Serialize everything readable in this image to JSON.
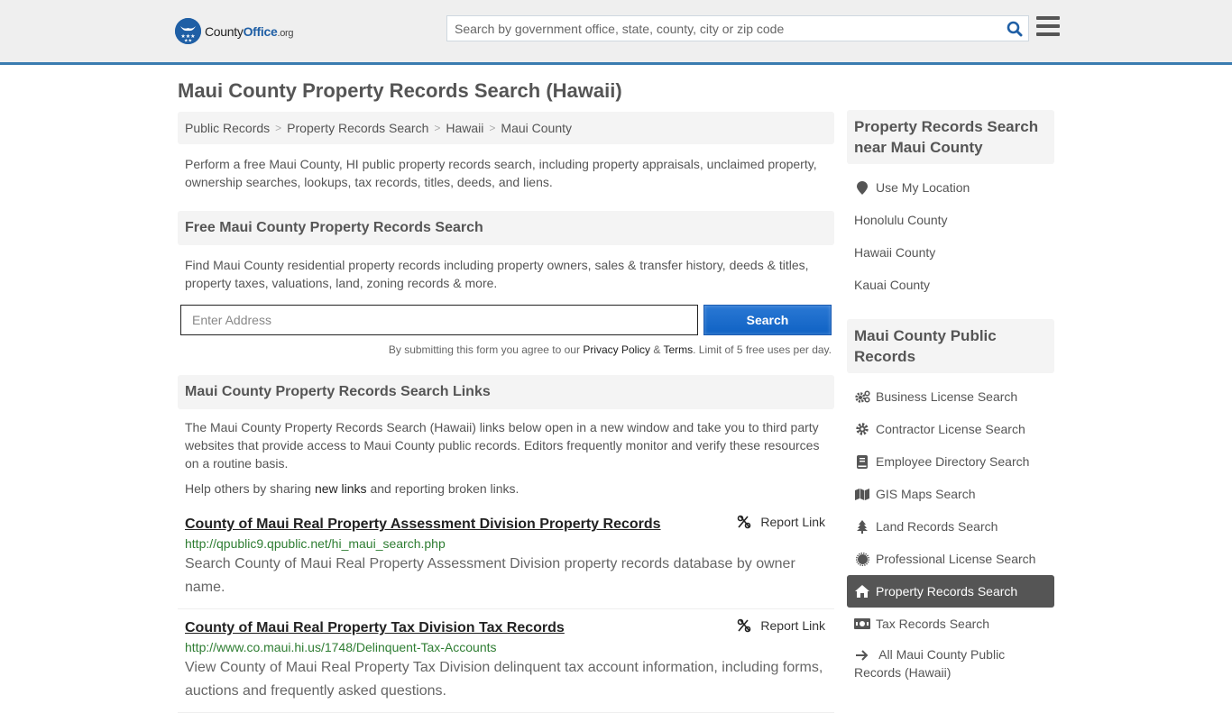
{
  "header": {
    "logo": {
      "brand_part1": "County",
      "brand_part2": "Office",
      "brand_tld": ".org"
    },
    "search": {
      "placeholder": "Search by government office, state, county, city or zip code",
      "value": ""
    },
    "accent_color": "#3a7cb0"
  },
  "page_title": "Maui County Property Records Search (Hawaii)",
  "breadcrumb": [
    {
      "label": "Public Records"
    },
    {
      "label": "Property Records Search"
    },
    {
      "label": "Hawaii"
    },
    {
      "label": "Maui County"
    }
  ],
  "intro": "Perform a free Maui County, HI public property records search, including property appraisals, unclaimed property, ownership searches, lookups, tax records, titles, deeds, and liens.",
  "free_search": {
    "heading": "Free Maui County Property Records Search",
    "description": "Find Maui County residential property records including property owners, sales & transfer history, deeds & titles, property taxes, valuations, land, zoning records & more.",
    "address_placeholder": "Enter Address",
    "address_value": "",
    "button_label": "Search",
    "disclaimer_prefix": "By submitting this form you agree to our ",
    "privacy_label": "Privacy Policy",
    "amp": " & ",
    "terms_label": "Terms",
    "disclaimer_suffix": ". Limit of 5 free uses per day."
  },
  "links_section": {
    "heading": "Maui County Property Records Search Links",
    "description": "The Maui County Property Records Search (Hawaii) links below open in a new window and take you to third party websites that provide access to Maui County public records. Editors frequently monitor and verify these resources on a routine basis.",
    "help_prefix": "Help others by sharing ",
    "help_link": "new links",
    "help_suffix": " and reporting broken links.",
    "report_label": "Report Link",
    "results": [
      {
        "title": "County of Maui Real Property Assessment Division Property Records",
        "url": "http://qpublic9.qpublic.net/hi_maui_search.php",
        "description": "Search County of Maui Real Property Assessment Division property records database by owner name."
      },
      {
        "title": "County of Maui Real Property Tax Division Tax Records",
        "url": "http://www.co.maui.hi.us/1748/Delinquent-Tax-Accounts",
        "description": "View County of Maui Real Property Tax Division delinquent tax account information, including forms, auctions and frequently asked questions."
      }
    ]
  },
  "sidebar": {
    "nearby": {
      "heading": "Property Records Search near Maui County",
      "use_location": "Use My Location",
      "items": [
        {
          "label": "Honolulu County"
        },
        {
          "label": "Hawaii County"
        },
        {
          "label": "Kauai County"
        }
      ]
    },
    "public_records": {
      "heading": "Maui County Public Records",
      "items": [
        {
          "label": "Business License Search",
          "icon": "cogs-icon"
        },
        {
          "label": "Contractor License Search",
          "icon": "gear-icon"
        },
        {
          "label": "Employee Directory Search",
          "icon": "book-icon"
        },
        {
          "label": "GIS Maps Search",
          "icon": "map-icon"
        },
        {
          "label": "Land Records Search",
          "icon": "tree-icon"
        },
        {
          "label": "Professional License Search",
          "icon": "certificate-icon"
        },
        {
          "label": "Property Records Search",
          "icon": "home-icon",
          "active": true
        },
        {
          "label": "Tax Records Search",
          "icon": "money-icon"
        },
        {
          "label": "All Maui County Public Records (Hawaii)",
          "icon": "arrow-right-icon"
        }
      ]
    }
  }
}
